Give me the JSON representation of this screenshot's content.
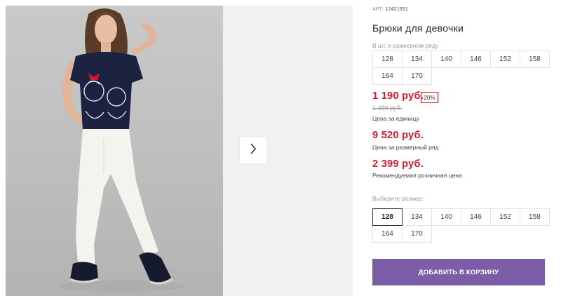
{
  "gallery": {
    "main_image": "girl-in-navy-tshirt-and-white-pants-photo",
    "next_icon": "chevron-right-icon"
  },
  "product": {
    "article_label": "АРТ:",
    "article_number": "12421551",
    "title": "Брюки для девочки",
    "pack_hint": "В шт. в размерном ряду",
    "pack_sizes": [
      "128",
      "134",
      "140",
      "146",
      "152",
      "158",
      "164",
      "170"
    ],
    "price": "1 190 руб.",
    "discount": "20%",
    "old_price": "1 490 руб.",
    "price_unit_label": "Цена за единицу",
    "pack_price": "9 520 руб.",
    "pack_price_label": "Цена за размерный ряд",
    "retail_price": "2 399 руб.",
    "retail_price_label": "Рекомендуемая розничная цена",
    "choose_size_label": "Выберите размер:",
    "sizes": [
      "128",
      "134",
      "140",
      "146",
      "152",
      "158",
      "164",
      "170"
    ],
    "selected_size": "128",
    "add_to_cart": "ДОБАВИТЬ В КОРЗИНУ"
  },
  "colors": {
    "accent_red": "#d6192f",
    "cart_button": "#7b5ea7",
    "shirt_navy": "#1c2340"
  }
}
